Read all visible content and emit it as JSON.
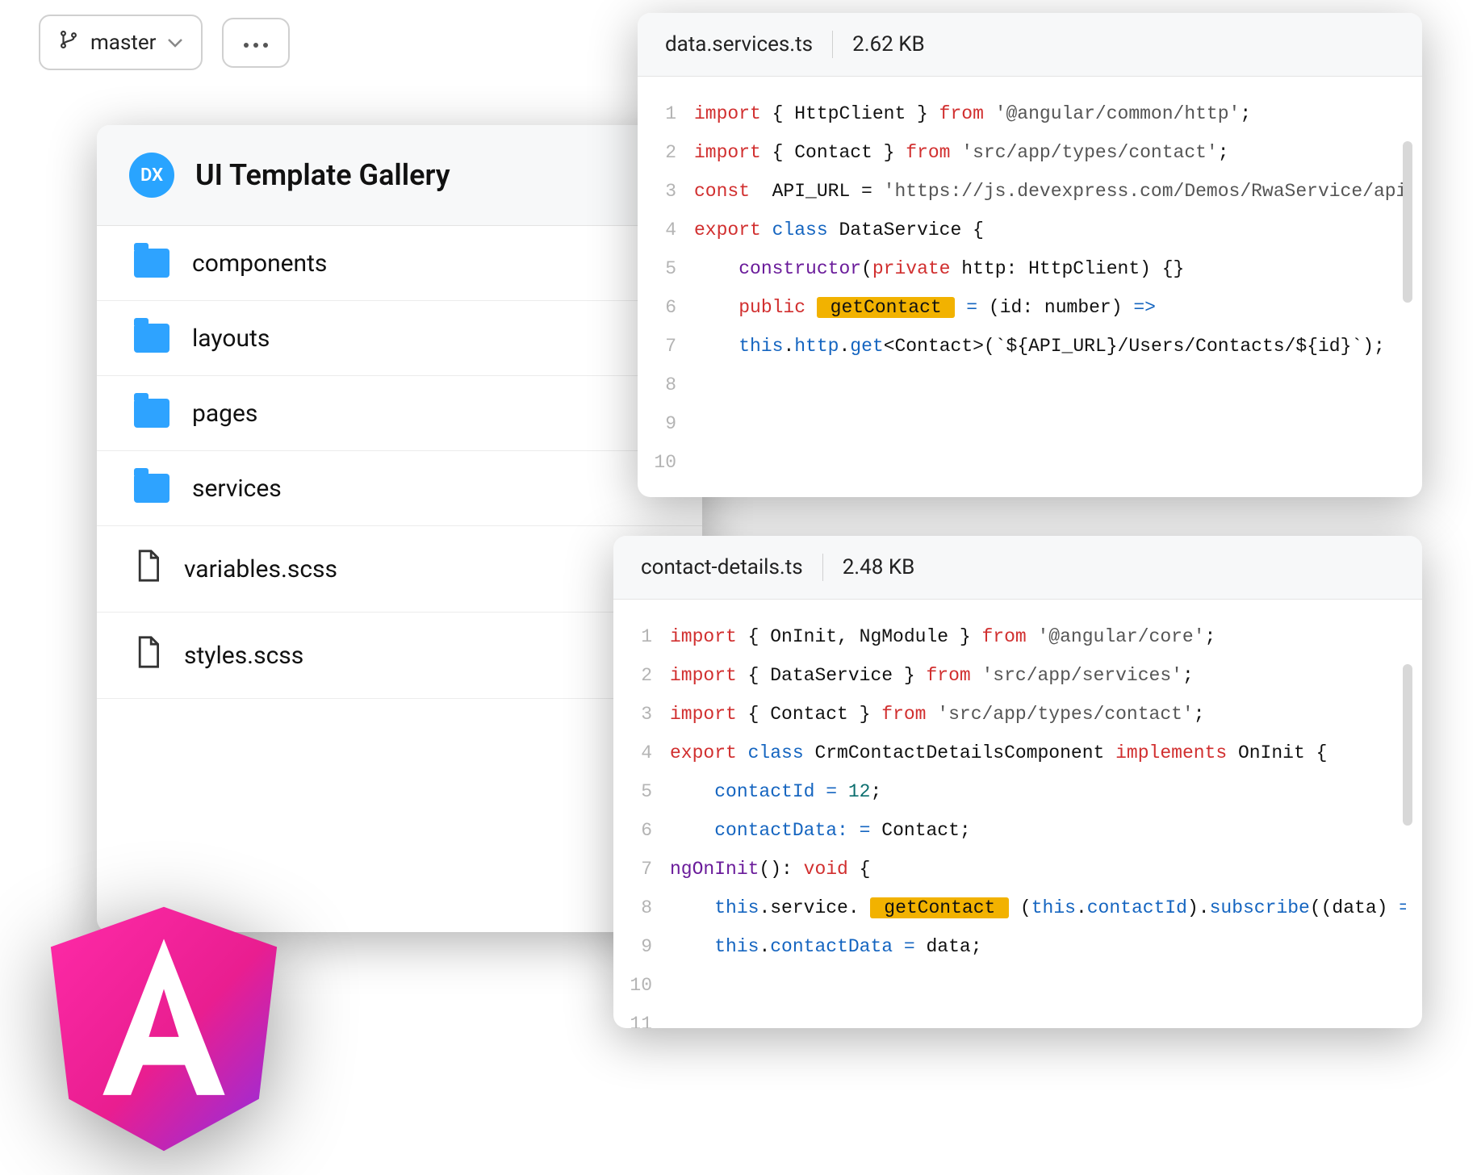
{
  "branch": {
    "label": "master"
  },
  "tree": {
    "badge": "DX",
    "title": "UI Template Gallery",
    "items": [
      {
        "type": "folder",
        "label": "components"
      },
      {
        "type": "folder",
        "label": "layouts"
      },
      {
        "type": "folder",
        "label": "pages"
      },
      {
        "type": "folder",
        "label": "services"
      },
      {
        "type": "file",
        "label": "variables.scss"
      },
      {
        "type": "file",
        "label": "styles.scss"
      }
    ]
  },
  "editors": [
    {
      "filename": "data.services.ts",
      "filesize": "2.62 KB",
      "lines": [
        [
          [
            "kw-red",
            "import "
          ],
          [
            "",
            "{ HttpClient } "
          ],
          [
            "kw-red",
            "from "
          ],
          [
            "kw-str",
            "'@angular/common/http'"
          ],
          [
            "",
            ";"
          ]
        ],
        [
          [
            "kw-red",
            "import "
          ],
          [
            "",
            "{ Contact } "
          ],
          [
            "kw-red",
            "from "
          ],
          [
            "kw-str",
            "'src/app/types/contact'"
          ],
          [
            "",
            ";"
          ]
        ],
        [
          [
            "",
            ""
          ]
        ],
        [
          [
            "kw-red",
            "const  "
          ],
          [
            "",
            "API_URL = "
          ],
          [
            "kw-str",
            "'https://js.devexpress.com/Demos/RwaService/api'"
          ],
          [
            "",
            ";"
          ]
        ],
        [
          [
            "",
            ""
          ]
        ],
        [
          [
            "kw-red",
            "export "
          ],
          [
            "kw-blue",
            "class "
          ],
          [
            "",
            "DataService {"
          ]
        ],
        [
          [
            "",
            "    "
          ],
          [
            "kw-purple",
            "constructor"
          ],
          [
            "",
            "("
          ],
          [
            "kw-red",
            "private "
          ],
          [
            "",
            "http: HttpClient) {}"
          ]
        ],
        [
          [
            "",
            ""
          ]
        ],
        [
          [
            "",
            "    "
          ],
          [
            "kw-red",
            "public "
          ],
          [
            "hl",
            " getContact "
          ],
          [
            "",
            ""
          ],
          [
            "kw-blue",
            " = "
          ],
          [
            "",
            "(id: number) "
          ],
          [
            "kw-blue",
            "=>"
          ]
        ],
        [
          [
            "",
            "    "
          ],
          [
            "kw-blue",
            "this"
          ],
          [
            "",
            "."
          ],
          [
            "kw-blue",
            "http"
          ],
          [
            "",
            "."
          ],
          [
            "kw-blue",
            "get"
          ],
          [
            "",
            "<Contact>(`${API_URL}/Users/Contacts/${id}`);"
          ]
        ]
      ]
    },
    {
      "filename": "contact-details.ts",
      "filesize": "2.48 KB",
      "lines": [
        [
          [
            "kw-red",
            "import "
          ],
          [
            "",
            "{ OnInit, NgModule } "
          ],
          [
            "kw-red",
            "from "
          ],
          [
            "kw-str",
            "'@angular/core'"
          ],
          [
            "",
            ";"
          ]
        ],
        [
          [
            "kw-red",
            "import "
          ],
          [
            "",
            "{ DataService } "
          ],
          [
            "kw-red",
            "from "
          ],
          [
            "kw-str",
            "'src/app/services'"
          ],
          [
            "",
            ";"
          ]
        ],
        [
          [
            "kw-red",
            "import "
          ],
          [
            "",
            "{ Contact } "
          ],
          [
            "kw-red",
            "from "
          ],
          [
            "kw-str",
            "'src/app/types/contact'"
          ],
          [
            "",
            ";"
          ]
        ],
        [
          [
            "",
            ""
          ]
        ],
        [
          [
            "kw-red",
            "export "
          ],
          [
            "kw-blue",
            "class "
          ],
          [
            "",
            "CrmContactDetailsComponent "
          ],
          [
            "kw-red",
            "implements "
          ],
          [
            "",
            "OnInit {"
          ]
        ],
        [
          [
            "",
            "    "
          ],
          [
            "kw-blue",
            "contactId"
          ],
          [
            "",
            ""
          ],
          [
            "kw-blue",
            " = "
          ],
          [
            "kw-teal",
            "12"
          ],
          [
            "",
            ";"
          ]
        ],
        [
          [
            "",
            "    "
          ],
          [
            "kw-blue",
            "contactData:"
          ],
          [
            "",
            ""
          ],
          [
            "kw-blue",
            " = "
          ],
          [
            "",
            "Contact;"
          ]
        ],
        [
          [
            "",
            ""
          ]
        ],
        [
          [
            "kw-purple",
            "ngOnInit"
          ],
          [
            "",
            "(): "
          ],
          [
            "kw-red",
            "void "
          ],
          [
            "",
            "{"
          ]
        ],
        [
          [
            "",
            "    "
          ],
          [
            "kw-blue",
            "this"
          ],
          [
            "",
            ".service. "
          ],
          [
            "hl",
            " getContact "
          ],
          [
            "",
            ""
          ],
          [
            "",
            " ("
          ],
          [
            "kw-blue",
            "this"
          ],
          [
            "",
            "."
          ],
          [
            "kw-blue",
            "contactId"
          ],
          [
            "",
            ")."
          ],
          [
            "kw-blue",
            "subscribe"
          ],
          [
            "",
            "((data) "
          ],
          [
            "kw-blue",
            "=>"
          ],
          [
            "",
            " {"
          ]
        ],
        [
          [
            "",
            "    "
          ],
          [
            "kw-blue",
            "this"
          ],
          [
            "",
            "."
          ],
          [
            "kw-blue",
            "contactData"
          ],
          [
            "",
            ""
          ],
          [
            "kw-blue",
            " = "
          ],
          [
            "",
            "data;"
          ]
        ]
      ]
    }
  ],
  "colors": {
    "folder": "#2ea3ff",
    "highlight": "#f2b200",
    "badge": "#29a4ff"
  }
}
